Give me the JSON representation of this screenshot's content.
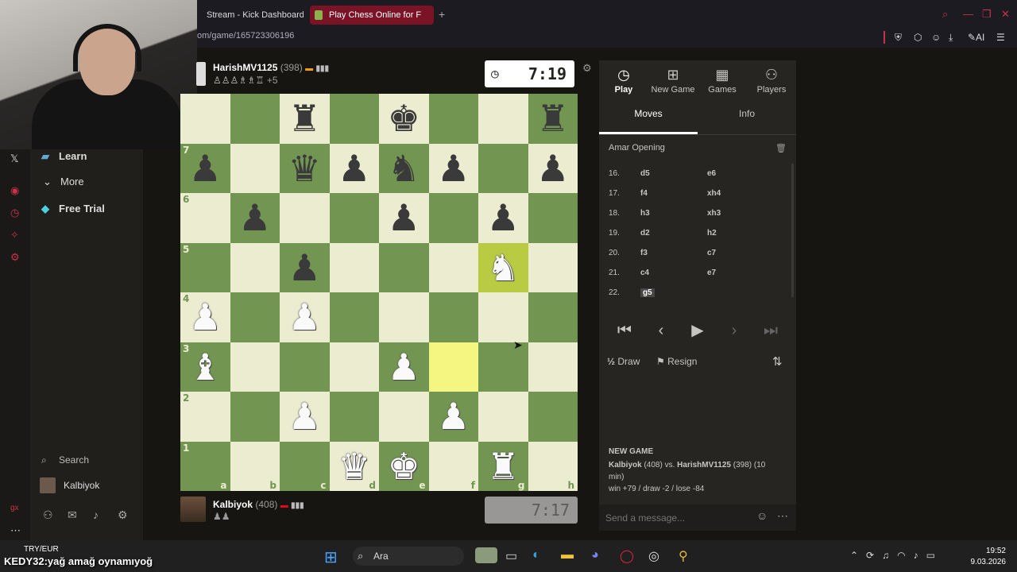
{
  "browser": {
    "tabs": [
      {
        "label": "Stream - Kick Dashboard"
      },
      {
        "label": "Play Chess Online for F"
      }
    ],
    "url": "om/game/165723306196"
  },
  "sidebar": {
    "items": [
      {
        "label": "Learn",
        "icon": "learn-icon"
      },
      {
        "label": "More",
        "icon": "chevron-down-icon"
      },
      {
        "label": "Free Trial",
        "icon": "diamond-icon"
      }
    ],
    "search_label": "Search",
    "user_name": "Kalbiyok"
  },
  "game": {
    "top_player": {
      "name": "HarishMV1125",
      "rating": "(398)",
      "clock": "7:19",
      "captured_extra": "+5"
    },
    "bottom_player": {
      "name": "Kalbiyok",
      "rating": "(408)",
      "clock": "7:17"
    },
    "board": [
      [
        "",
        "",
        "br",
        "",
        "bk",
        "",
        "",
        "br"
      ],
      [
        "bp",
        "",
        "bq",
        "bp",
        "bn",
        "bp",
        "",
        "bp"
      ],
      [
        "",
        "bp",
        "",
        "",
        "bp",
        "",
        "bp",
        ""
      ],
      [
        "",
        "",
        "bp",
        "",
        "",
        "",
        "wn",
        ""
      ],
      [
        "wp",
        "",
        "wp",
        "",
        "",
        "",
        "",
        ""
      ],
      [
        "wb",
        "",
        "",
        "",
        "wp",
        "",
        "",
        ""
      ],
      [
        "",
        "",
        "wp",
        "",
        "",
        "wp",
        "",
        ""
      ],
      [
        "",
        "",
        "",
        "wq",
        "wk",
        "",
        "wr",
        ""
      ]
    ],
    "ranks": [
      "",
      "7",
      "6",
      "5",
      "4",
      "3",
      "2",
      "1"
    ],
    "files": [
      "a",
      "b",
      "c",
      "d",
      "e",
      "f",
      "g",
      "h"
    ]
  },
  "panel": {
    "tabs": [
      {
        "label": "Play",
        "icon": "stopwatch-icon"
      },
      {
        "label": "New Game",
        "icon": "plus-icon"
      },
      {
        "label": "Games",
        "icon": "board-icon"
      },
      {
        "label": "Players",
        "icon": "players-icon"
      }
    ],
    "subtabs": [
      {
        "label": "Moves"
      },
      {
        "label": "Info"
      }
    ],
    "opening": "Amar Opening",
    "moves": [
      {
        "num": "16.",
        "white": "d5",
        "black": "e6"
      },
      {
        "num": "17.",
        "white": "f4",
        "black": "xh4"
      },
      {
        "num": "18.",
        "white": "h3",
        "black": "xh3"
      },
      {
        "num": "19.",
        "white": "d2",
        "black": "h2"
      },
      {
        "num": "20.",
        "white": "f3",
        "black": "c7"
      },
      {
        "num": "21.",
        "white": "c4",
        "black": "e7"
      },
      {
        "num": "22.",
        "white": "g5",
        "black": ""
      }
    ],
    "draw_label": "Draw",
    "draw_prefix": "½",
    "resign_label": "Resign",
    "new_game": {
      "heading": "NEW GAME",
      "line1_a": "Kalbiyok",
      "line1_b": "(408) vs.",
      "line1_c": "HarishMV1125",
      "line1_d": "(398) (10",
      "line2": "min)",
      "line3": "win +79 / draw -2 / lose -84"
    },
    "message_placeholder": "Send a message..."
  },
  "overlay": {
    "currency": "TRY/EUR",
    "stream_text": "KEDY32:yağ amağ oynamıyoğ"
  },
  "taskbar": {
    "search_label": "Ara",
    "time": "19:52",
    "date": "9.03.2026"
  },
  "colors": {
    "light_square": "#ebecd0",
    "dark_square": "#739552",
    "highlight": "#f5f682",
    "accent": "#c8334a"
  }
}
